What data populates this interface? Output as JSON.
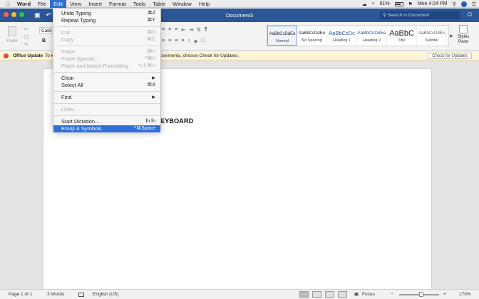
{
  "menubar": {
    "app": "Word",
    "menus": [
      "File",
      "Edit",
      "View",
      "Insert",
      "Format",
      "Tools",
      "Table",
      "Window",
      "Help"
    ],
    "active_menu": "Edit",
    "battery": "61%",
    "clock": "Mon 4:24 PM"
  },
  "titlebar": {
    "document_title": "Document3",
    "search_placeholder": "Search in Document"
  },
  "ribbon": {
    "paste_label": "Paste",
    "font_name": "Calibri",
    "bold_label": "B",
    "styles": [
      {
        "sample": "AaBbCcDdEe",
        "name": "Normal"
      },
      {
        "sample": "AaBbCcDdEe",
        "name": "No Spacing"
      },
      {
        "sample": "AaBbCcDc",
        "name": "Heading 1"
      },
      {
        "sample": "AaBbCcDdEe",
        "name": "Heading 2"
      },
      {
        "sample": "AaBbC",
        "name": "Title"
      },
      {
        "sample": "AaBbCcDdEe",
        "name": "Subtitle"
      }
    ],
    "styles_pane_label": "Styles Pane"
  },
  "update_bar": {
    "title": "Office Update",
    "prefix": "To k",
    "message": "ovements, choose Check for Updates.",
    "button": "Check for Updates"
  },
  "document": {
    "visible_text": "EYBOARD"
  },
  "edit_menu": {
    "groups": [
      [
        {
          "label": "Undo Typing",
          "shortcut": "⌘Z",
          "enabled": true
        },
        {
          "label": "Repeat Typing",
          "shortcut": "⌘Y",
          "enabled": true
        }
      ],
      [
        {
          "label": "Cut",
          "shortcut": "⌘X",
          "enabled": false
        },
        {
          "label": "Copy",
          "shortcut": "⌘C",
          "enabled": false
        }
      ],
      [
        {
          "label": "Paste",
          "shortcut": "⌘V",
          "enabled": false
        },
        {
          "label": "Paste Special...",
          "shortcut": "^⌘V",
          "enabled": false
        },
        {
          "label": "Paste and Match Formatting",
          "shortcut": "⌥⇧⌘V",
          "enabled": false
        }
      ],
      [
        {
          "label": "Clear",
          "submenu": true,
          "enabled": true
        },
        {
          "label": "Select All",
          "shortcut": "⌘A",
          "enabled": true
        }
      ],
      [
        {
          "label": "Find",
          "submenu": true,
          "enabled": true
        }
      ],
      [
        {
          "label": "Links...",
          "enabled": false
        }
      ],
      [
        {
          "label": "Start Dictation...",
          "shortcut": "fn fn",
          "enabled": true
        },
        {
          "label": "Emoji & Symbols",
          "shortcut": "^⌘Space",
          "enabled": true,
          "highlighted": true
        }
      ]
    ]
  },
  "statusbar": {
    "page": "Page 1 of 1",
    "words": "3 Words",
    "language": "English (US)",
    "focus": "Focus",
    "zoom": "170%"
  }
}
